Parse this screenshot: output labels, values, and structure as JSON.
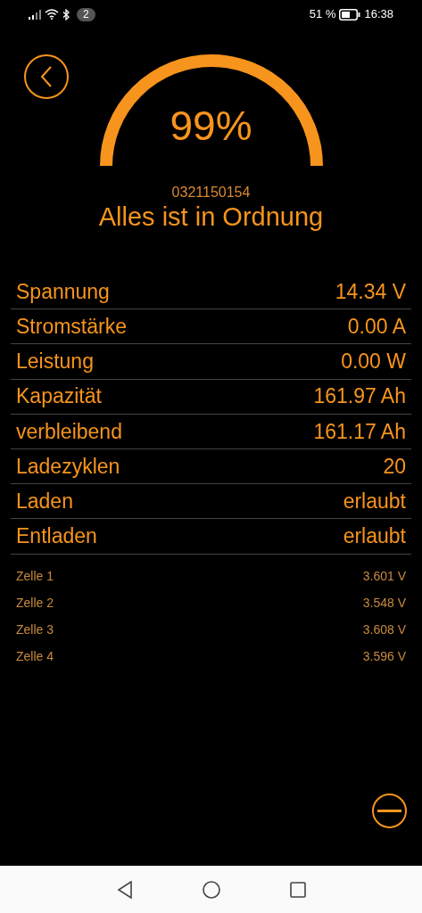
{
  "status_bar": {
    "notification_count": "2",
    "battery_percent": "51 %",
    "time": "16:38"
  },
  "gauge": {
    "reading": "99%"
  },
  "serial": "0321150154",
  "status": "Alles ist in Ordnung",
  "metrics": [
    {
      "label": "Spannung",
      "value": "14.34 V"
    },
    {
      "label": "Stromstärke",
      "value": "0.00 A"
    },
    {
      "label": "Leistung",
      "value": "0.00 W"
    },
    {
      "label": "Kapazität",
      "value": "161.97 Ah"
    },
    {
      "label": "verbleibend",
      "value": "161.17 Ah"
    },
    {
      "label": "Ladezyklen",
      "value": "20"
    },
    {
      "label": "Laden",
      "value": "erlaubt"
    },
    {
      "label": "Entladen",
      "value": "erlaubt"
    }
  ],
  "cells": [
    {
      "label": "Zelle 1",
      "value": "3.601 V"
    },
    {
      "label": "Zelle 2",
      "value": "3.548 V"
    },
    {
      "label": "Zelle 3",
      "value": "3.608 V"
    },
    {
      "label": "Zelle 4",
      "value": "3.596 V"
    }
  ]
}
